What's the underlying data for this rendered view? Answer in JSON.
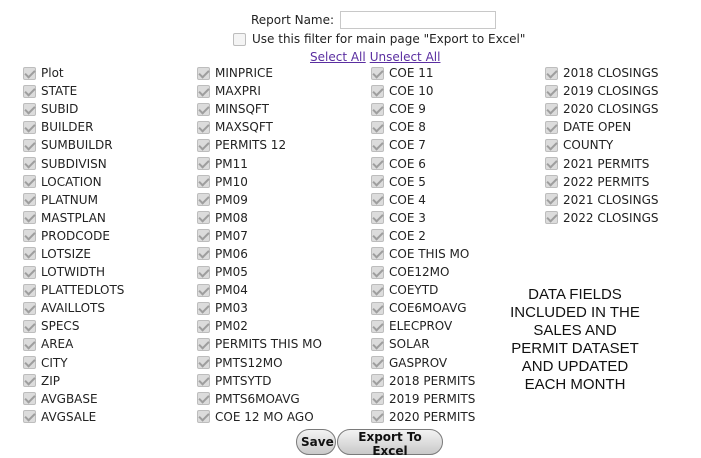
{
  "header": {
    "report_name_label": "Report Name:",
    "report_name_value": "",
    "filter_label": "Use this filter for main page \"Export to Excel\"",
    "select_all": "Select All",
    "unselect_all": "Unselect All"
  },
  "columns": [
    {
      "items": [
        {
          "label": "Plot",
          "checked": true
        },
        {
          "label": "STATE",
          "checked": true
        },
        {
          "label": "SUBID",
          "checked": true
        },
        {
          "label": "BUILDER",
          "checked": true
        },
        {
          "label": "SUMBUILDR",
          "checked": true
        },
        {
          "label": "SUBDIVISN",
          "checked": true
        },
        {
          "label": "LOCATION",
          "checked": true
        },
        {
          "label": "PLATNUM",
          "checked": true
        },
        {
          "label": "MASTPLAN",
          "checked": true
        },
        {
          "label": "PRODCODE",
          "checked": true
        },
        {
          "label": "LOTSIZE",
          "checked": true
        },
        {
          "label": "LOTWIDTH",
          "checked": true
        },
        {
          "label": "PLATTEDLOTS",
          "checked": true
        },
        {
          "label": "AVAILLOTS",
          "checked": true
        },
        {
          "label": "SPECS",
          "checked": true
        },
        {
          "label": "AREA",
          "checked": true
        },
        {
          "label": "CITY",
          "checked": true
        },
        {
          "label": "ZIP",
          "checked": true
        },
        {
          "label": "AVGBASE",
          "checked": true
        },
        {
          "label": "AVGSALE",
          "checked": true
        }
      ]
    },
    {
      "items": [
        {
          "label": "MINPRICE",
          "checked": true
        },
        {
          "label": "MAXPRI",
          "checked": true
        },
        {
          "label": "MINSQFT",
          "checked": true
        },
        {
          "label": "MAXSQFT",
          "checked": true
        },
        {
          "label": "PERMITS 12",
          "checked": true
        },
        {
          "label": "PM11",
          "checked": true
        },
        {
          "label": "PM10",
          "checked": true
        },
        {
          "label": "PM09",
          "checked": true
        },
        {
          "label": "PM08",
          "checked": true
        },
        {
          "label": "PM07",
          "checked": true
        },
        {
          "label": "PM06",
          "checked": true
        },
        {
          "label": "PM05",
          "checked": true
        },
        {
          "label": "PM04",
          "checked": true
        },
        {
          "label": "PM03",
          "checked": true
        },
        {
          "label": "PM02",
          "checked": true
        },
        {
          "label": "PERMITS THIS MO",
          "checked": true
        },
        {
          "label": "PMTS12MO",
          "checked": true
        },
        {
          "label": "PMTSYTD",
          "checked": true
        },
        {
          "label": "PMTS6MOAVG",
          "checked": true
        },
        {
          "label": "COE 12 MO AGO",
          "checked": true
        }
      ]
    },
    {
      "items": [
        {
          "label": "COE 11",
          "checked": true
        },
        {
          "label": "COE 10",
          "checked": true
        },
        {
          "label": "COE 9",
          "checked": true
        },
        {
          "label": "COE 8",
          "checked": true
        },
        {
          "label": "COE 7",
          "checked": true
        },
        {
          "label": "COE 6",
          "checked": true
        },
        {
          "label": "COE 5",
          "checked": true
        },
        {
          "label": "COE 4",
          "checked": true
        },
        {
          "label": "COE 3",
          "checked": true
        },
        {
          "label": "COE 2",
          "checked": true
        },
        {
          "label": "COE THIS MO",
          "checked": true
        },
        {
          "label": "COE12MO",
          "checked": true
        },
        {
          "label": "COEYTD",
          "checked": true
        },
        {
          "label": "COE6MOAVG",
          "checked": true
        },
        {
          "label": "ELECPROV",
          "checked": true
        },
        {
          "label": "SOLAR",
          "checked": true
        },
        {
          "label": "GASPROV",
          "checked": true
        },
        {
          "label": "2018 PERMITS",
          "checked": true
        },
        {
          "label": "2019 PERMITS",
          "checked": true
        },
        {
          "label": "2020 PERMITS",
          "checked": true
        }
      ]
    },
    {
      "items": [
        {
          "label": "2018 CLOSINGS",
          "checked": true
        },
        {
          "label": "2019 CLOSINGS",
          "checked": true
        },
        {
          "label": "2020 CLOSINGS",
          "checked": true
        },
        {
          "label": "DATE OPEN",
          "checked": true
        },
        {
          "label": "COUNTY",
          "checked": true
        },
        {
          "label": "2021 PERMITS",
          "checked": true
        },
        {
          "label": "2022 PERMITS",
          "checked": true
        },
        {
          "label": "2021 CLOSINGS",
          "checked": true
        },
        {
          "label": "2022 CLOSINGS",
          "checked": true
        }
      ]
    }
  ],
  "note": "DATA FIELDS INCLUDED IN THE SALES AND PERMIT DATASET AND UPDATED EACH MONTH",
  "buttons": {
    "save": "Save",
    "export": "Export To Excel"
  }
}
